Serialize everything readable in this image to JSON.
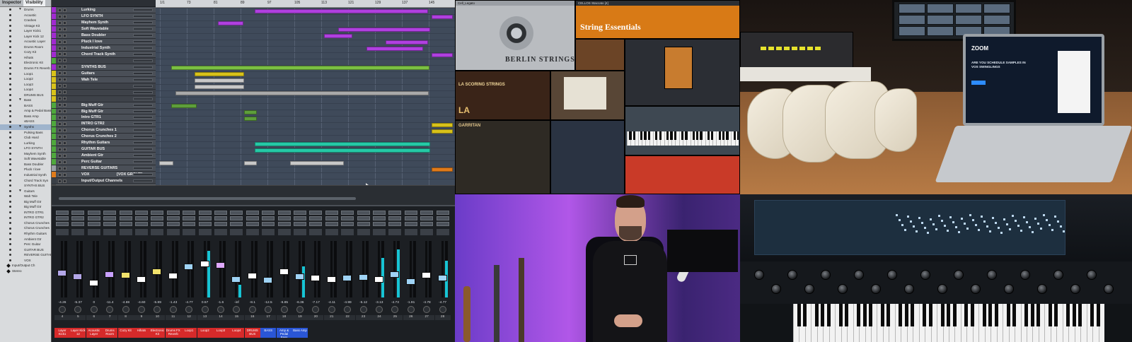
{
  "inspector": {
    "tabs": [
      "Inspector",
      "Visibility"
    ],
    "visibility_items": [
      {
        "label": "Drums",
        "folder": true
      },
      {
        "label": "Acoustic"
      },
      {
        "label": "Crashes"
      },
      {
        "label": "Vintage Kit"
      },
      {
        "label": "Layer Kick1"
      },
      {
        "label": "Layer Kick 12"
      },
      {
        "label": "Acoustic Layer"
      },
      {
        "label": "Drums Room"
      },
      {
        "label": "Cozy Kit"
      },
      {
        "label": "Hihats"
      },
      {
        "label": "Electronic Kit"
      },
      {
        "label": "Drums FX Reverb"
      },
      {
        "label": "Loop1"
      },
      {
        "label": "Loop2"
      },
      {
        "label": "Loop3"
      },
      {
        "label": "Loop4"
      },
      {
        "label": "DRUMS BUS"
      },
      {
        "label": "Bass",
        "folder": true
      },
      {
        "label": "BASS"
      },
      {
        "label": "Amp & Pedal Bass"
      },
      {
        "label": "Bass Amp"
      },
      {
        "label": "vBASS"
      },
      {
        "label": "Synths",
        "folder": true,
        "selected": true
      },
      {
        "label": "Pulsing Bass"
      },
      {
        "label": "Club Hard"
      },
      {
        "label": "Lurking"
      },
      {
        "label": "LFO SYNTH"
      },
      {
        "label": "Mayhem Synth"
      },
      {
        "label": "Soft Wavetable"
      },
      {
        "label": "Bass Doubler"
      },
      {
        "label": "Pluck I love"
      },
      {
        "label": "Industrial Synth"
      },
      {
        "label": "Chord Track Syn"
      },
      {
        "label": "SYNTHS BUS"
      },
      {
        "label": "Guitars",
        "folder": true
      },
      {
        "label": "Wah Tele"
      },
      {
        "label": "Big Muff Gtr"
      },
      {
        "label": "Big Muff Gtr"
      },
      {
        "label": "INTRO GTR1"
      },
      {
        "label": "INTRO GTR2"
      },
      {
        "label": "Chorus Crunches"
      },
      {
        "label": "Chorus Crunches"
      },
      {
        "label": "Rhythm Guitars"
      },
      {
        "label": "Ambient Gtr"
      },
      {
        "label": "Perc Guitar"
      },
      {
        "label": "GUITAR BUS"
      },
      {
        "label": "REVERSE GUITAR"
      },
      {
        "label": "VOX"
      },
      {
        "label": "Input/Output Ch",
        "tail": true
      },
      {
        "label": "Stereo",
        "tail": true
      }
    ]
  },
  "tracks": [
    {
      "name": "Lurking",
      "color": "#a12ad0"
    },
    {
      "name": "LFO SYNTH",
      "color": "#a12ad0"
    },
    {
      "name": "Mayhem Synth",
      "color": "#a12ad0"
    },
    {
      "name": "Soft Wavetable",
      "color": "#a12ad0"
    },
    {
      "name": "Bass Doubler",
      "color": "#a12ad0"
    },
    {
      "name": "Pluck I love",
      "color": "#a12ad0"
    },
    {
      "name": "Industrial Synth",
      "color": "#a12ad0"
    },
    {
      "name": "Chord Track Synth",
      "color": "#a12ad0"
    },
    {
      "name": "",
      "color": "#4fa83c",
      "group": true
    },
    {
      "name": "SYNTHS BUS",
      "color": "#a12ad0"
    },
    {
      "name": "Guitars",
      "color": "#d8c21a"
    },
    {
      "name": "Wah Tele",
      "color": "#d8c21a"
    },
    {
      "name": "",
      "color": "#d8c21a",
      "group": true
    },
    {
      "name": "",
      "color": "#d8c21a",
      "group": true
    },
    {
      "name": "",
      "color": "#d8c21a",
      "group": true
    },
    {
      "name": "Big Muff Gtr",
      "color": "#4fa83c"
    },
    {
      "name": "Big Muff Gtr",
      "color": "#4fa83c"
    },
    {
      "name": "Intro GTR1",
      "color": "#4fa83c"
    },
    {
      "name": "INTRO GTR2",
      "color": "#4fa83c"
    },
    {
      "name": "Chorus Crunches 1",
      "color": "#4fa83c"
    },
    {
      "name": "Chorus Crunches 2",
      "color": "#4fa83c"
    },
    {
      "name": "Rhythm Guitars",
      "color": "#4fa83c"
    },
    {
      "name": "GUITAR BUS",
      "color": "#4fa83c"
    },
    {
      "name": "Ambient Gtr",
      "color": "#4fa83c"
    },
    {
      "name": "Perc Guitar",
      "color": "#4fa83c"
    },
    {
      "name": "REVERSE GUITARS",
      "color": "#9aa0a6"
    },
    {
      "name": "VOX",
      "color": "#e07b1a",
      "tag": "[VOX GROUP]"
    },
    {
      "name": "Input/Output Channels",
      "color": "#3a3f46",
      "group": true
    },
    {
      "name": "Stereo",
      "color": "#555",
      "key": true
    }
  ],
  "ruler": [
    "1/1",
    "73",
    "81",
    "89",
    "97",
    "105",
    "113",
    "121",
    "129",
    "137",
    "145",
    "153"
  ],
  "mixer": {
    "values": [
      "-4.26",
      "-5.37",
      "0",
      "-11.4",
      "-4.69",
      "-4.60",
      "-5.89",
      "-1.43",
      "-4.77",
      "0.57",
      "-1.6",
      "-inf",
      "-8.1",
      "-12.5",
      "-6.85",
      "-6.36",
      "-7.17",
      "-4.11",
      "-4.99",
      "-5.12",
      "-3.13",
      "-4.73",
      "-1.91",
      "-4.78",
      "-4.77"
    ],
    "numbers": [
      "4",
      "5",
      "6",
      "7",
      "8",
      "9",
      "10",
      "11",
      "12",
      "13",
      "14",
      "15",
      "16",
      "17",
      "18",
      "19",
      "20",
      "21",
      "22",
      "23",
      "24",
      "25",
      "26",
      "27",
      "28"
    ],
    "labels": [
      "Layer Kick1",
      "Layer Kick 12",
      "Acoustic Layer",
      "Drums Room",
      "Cozy Kit",
      "Hihats",
      "Electronic Kit",
      "Drums FX Reverb",
      "Loop1",
      "Loop2",
      "Loop3",
      "Loop4",
      "DRUMS BUS",
      "BASS",
      "Amp & Pedal Bass",
      "Bass Amp"
    ],
    "label_colors": [
      "#d62a2a",
      "#d62a2a",
      "#d62a2a",
      "#d62a2a",
      "#d62a2a",
      "#d62a2a",
      "#d62a2a",
      "#d62a2a",
      "#d62a2a",
      "#d62a2a",
      "#d62a2a",
      "#d62a2a",
      "#d62a2a",
      "#2a56d6",
      "#2a56d6",
      "#2a56d6"
    ],
    "fader_levels": [
      0.42,
      0.35,
      0.22,
      0.4,
      0.38,
      0.3,
      0.45,
      0.36,
      0.55,
      0.6,
      0.58,
      0.3,
      0.37,
      0.28,
      0.45,
      0.35,
      0.33,
      0.3,
      0.32,
      0.34,
      0.3,
      0.4,
      0.25,
      0.38,
      0.32
    ],
    "meter_levels": [
      0,
      0,
      0,
      0,
      0,
      0,
      0,
      0,
      0,
      0.82,
      0,
      0.22,
      0,
      0,
      0,
      0.55,
      0,
      0,
      0,
      0,
      0.7,
      0.85,
      0,
      0,
      0.65
    ],
    "fader_colors": [
      "#b3a7e8",
      "#b3a7e8",
      "#ffffff",
      "#c9a1ff",
      "#f1e26c",
      "#ffffff",
      "#f1e26c",
      "#ffffff",
      "#9fd3f5",
      "#ffffff",
      "#dfa9ff",
      "#9fd3f5",
      "#ffffff",
      "#9fd3f5",
      "#ffffff",
      "#9fd3f5",
      "#ffffff",
      "#ffffff",
      "#9fd3f5",
      "#9fd3f5",
      "#ffffff",
      "#9fd3f5",
      "#9fd3f5",
      "#ffffff",
      "#9fd3f5"
    ]
  },
  "plugins": {
    "titles": [
      "Cell_Legato",
      "CELLOS Staccato [4]",
      "String Essentials",
      "BERLIN STRINGS",
      "LA SCORING STRINGS",
      "GARRITAN"
    ]
  },
  "laptop": {
    "brand": "ZOOM",
    "text": "ARE YOU SCHEDULE SAMPLES IN VOS SWINGLINGS"
  }
}
